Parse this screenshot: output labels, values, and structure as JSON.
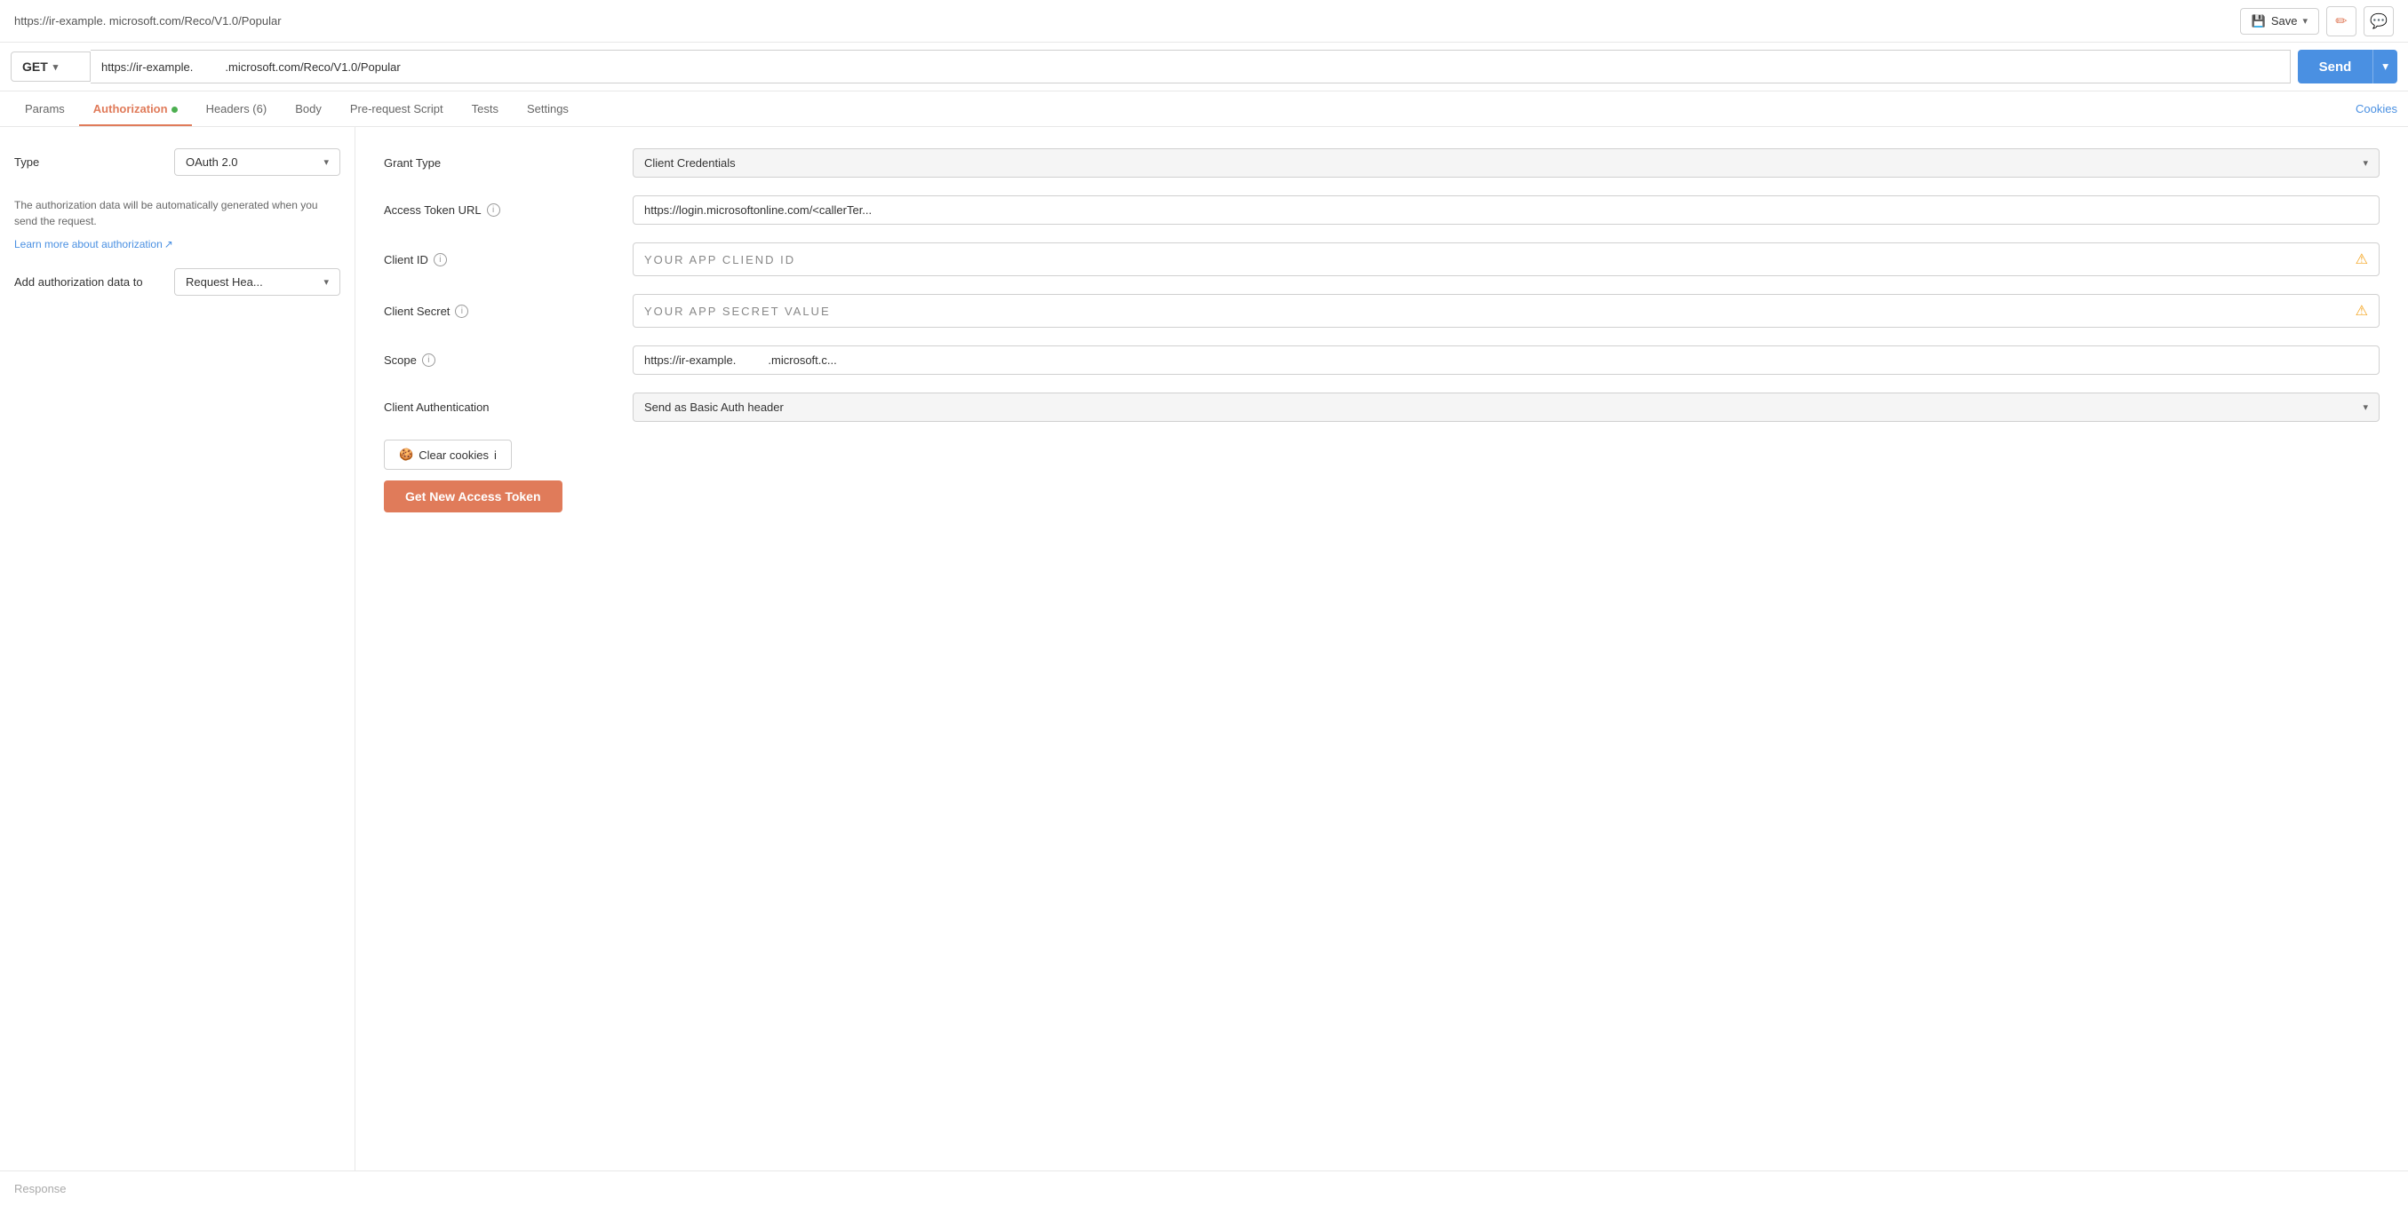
{
  "topbar": {
    "url_display": "https://ir-example.          microsoft.com/Reco/V1.0/Popular",
    "save_label": "Save",
    "edit_icon": "✏",
    "comment_icon": "💬"
  },
  "urlbar": {
    "method": "GET",
    "url": "https://ir-example.          .microsoft.com/Reco/V1.0/Popular",
    "send_label": "Send"
  },
  "tabs": {
    "items": [
      {
        "label": "Params",
        "active": false
      },
      {
        "label": "Authorization",
        "active": true,
        "dot": true
      },
      {
        "label": "Headers (6)",
        "active": false
      },
      {
        "label": "Body",
        "active": false
      },
      {
        "label": "Pre-request Script",
        "active": false
      },
      {
        "label": "Tests",
        "active": false
      },
      {
        "label": "Settings",
        "active": false
      }
    ],
    "cookies_label": "Cookies"
  },
  "left_panel": {
    "type_label": "Type",
    "type_value": "OAuth 2.0",
    "info_text": "The authorization data will be automatically generated when you send the request.",
    "learn_more_label": "Learn more about authorization",
    "learn_more_arrow": "↗",
    "add_auth_label": "Add authorization data to",
    "add_auth_value": "Request Hea..."
  },
  "right_panel": {
    "grant_type": {
      "label": "Grant Type",
      "value": "Client Credentials"
    },
    "access_token_url": {
      "label": "Access Token URL",
      "info": "i",
      "value": "https://login.microsoftonline.com/<callerTer..."
    },
    "client_id": {
      "label": "Client ID",
      "info": "i",
      "value": "YOUR  APP  CLIEND  ID"
    },
    "client_secret": {
      "label": "Client Secret",
      "info": "i",
      "value": "YOUR  APP  SECRET  VALUE"
    },
    "scope": {
      "label": "Scope",
      "info": "i",
      "value": "https://ir-example.          .microsoft.c..."
    },
    "client_auth": {
      "label": "Client Authentication",
      "value": "Send as Basic Auth header"
    },
    "clear_cookies_label": "Clear cookies",
    "clear_info": "i",
    "get_token_label": "Get New Access Token"
  },
  "response": {
    "label": "Response"
  }
}
